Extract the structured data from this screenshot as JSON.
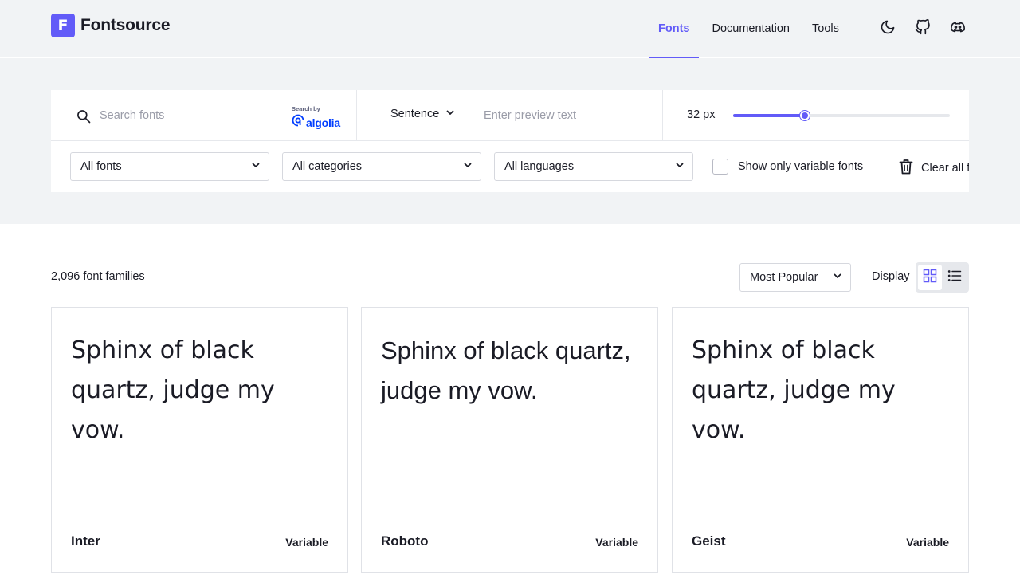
{
  "header": {
    "logo_letter": "F",
    "logo_text": "Fontsource",
    "nav": [
      {
        "label": "Fonts",
        "active": true
      },
      {
        "label": "Documentation",
        "active": false
      },
      {
        "label": "Tools",
        "active": false
      }
    ],
    "icons": [
      "moon-icon",
      "github-icon",
      "discord-icon"
    ],
    "accent_color": "#625bf8"
  },
  "toolbar": {
    "search_placeholder": "Search fonts",
    "search_by": "Search by",
    "algolia": "algolia",
    "preview_mode": "Sentence",
    "preview_placeholder": "Enter preview text",
    "size_label": "32 px",
    "size_slider_fraction": 0.33,
    "filters": {
      "fonts": "All fonts",
      "categories": "All categories",
      "languages": "All languages"
    },
    "variable_only_label": "Show only variable fonts",
    "variable_only_checked": false,
    "clear_label": "Clear all filters"
  },
  "results": {
    "count_label": "2,096 font families",
    "sort_value": "Most Popular",
    "display_label": "Display",
    "display_mode": "grid"
  },
  "cards": [
    {
      "preview": "Sphinx of black quartz, judge my vow.",
      "name": "Inter",
      "badge": "Variable"
    },
    {
      "preview": "Sphinx of black quartz, judge my vow.",
      "name": "Roboto",
      "badge": "Variable"
    },
    {
      "preview": "Sphinx of black quartz, judge my vow.",
      "name": "Geist",
      "badge": "Variable"
    }
  ]
}
